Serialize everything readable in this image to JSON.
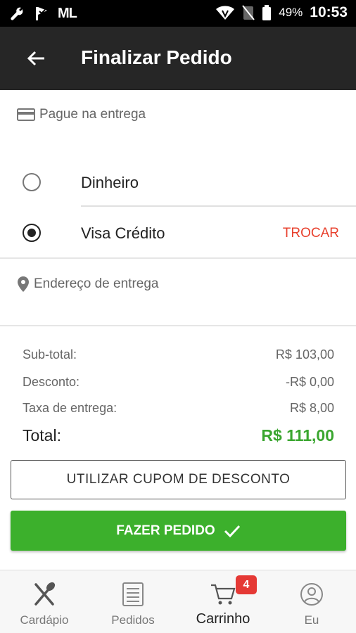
{
  "status_bar": {
    "battery_pct": "49%",
    "time": "10:53",
    "carrier_text": "ML"
  },
  "app_bar": {
    "title": "Finalizar Pedido"
  },
  "payment": {
    "header": "Pague na entrega",
    "options": [
      {
        "label": "Dinheiro",
        "selected": false
      },
      {
        "label": "Visa Crédito",
        "selected": true,
        "action": "TROCAR"
      }
    ]
  },
  "address": {
    "header": "Endereço de entrega"
  },
  "summary": {
    "subtotal_label": "Sub-total:",
    "subtotal_value": "R$ 103,00",
    "discount_label": "Desconto:",
    "discount_value": "-R$ 0,00",
    "delivery_label": "Taxa de entrega:",
    "delivery_value": "R$ 8,00",
    "total_label": "Total:",
    "total_value": "R$ 111,00"
  },
  "buttons": {
    "coupon": "UTILIZAR CUPOM DE DESCONTO",
    "order": "FAZER PEDIDO"
  },
  "bottom_nav": {
    "items": [
      {
        "label": "Cardápio",
        "icon": "cutlery-icon"
      },
      {
        "label": "Pedidos",
        "icon": "list-icon"
      },
      {
        "label": "Carrinho",
        "icon": "cart-icon",
        "active": true,
        "badge": "4"
      },
      {
        "label": "Eu",
        "icon": "user-icon"
      }
    ]
  },
  "colors": {
    "accent_green": "#3cb02c",
    "total_green": "#3aa62f",
    "action_red": "#e8412e",
    "app_bar": "#262626",
    "badge_red": "#e53935"
  }
}
